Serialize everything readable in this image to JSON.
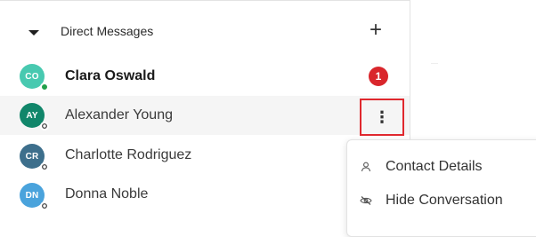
{
  "sidebar": {
    "section_title": "Direct Messages",
    "add_label": "+",
    "contacts": [
      {
        "initials": "CO",
        "name": "Clara Oswald",
        "avatar_color": "#48c9b0",
        "status": "online",
        "unread": "1"
      },
      {
        "initials": "AY",
        "name": "Alexander Young",
        "avatar_color": "#11866a",
        "status": "offline",
        "more_label": "⋮"
      },
      {
        "initials": "CR",
        "name": "Charlotte Rodriguez",
        "avatar_color": "#3d6f8c",
        "status": "offline"
      },
      {
        "initials": "DN",
        "name": "Donna Noble",
        "avatar_color": "#4aa3dc",
        "status": "offline"
      }
    ]
  },
  "context_menu": {
    "items": [
      {
        "label": "Contact Details",
        "icon": "user-icon"
      },
      {
        "label": "Hide Conversation",
        "icon": "eye-off-icon"
      }
    ]
  },
  "colors": {
    "highlight": "#e0282e",
    "unread_badge": "#d9262c",
    "online": "#20a04a"
  }
}
